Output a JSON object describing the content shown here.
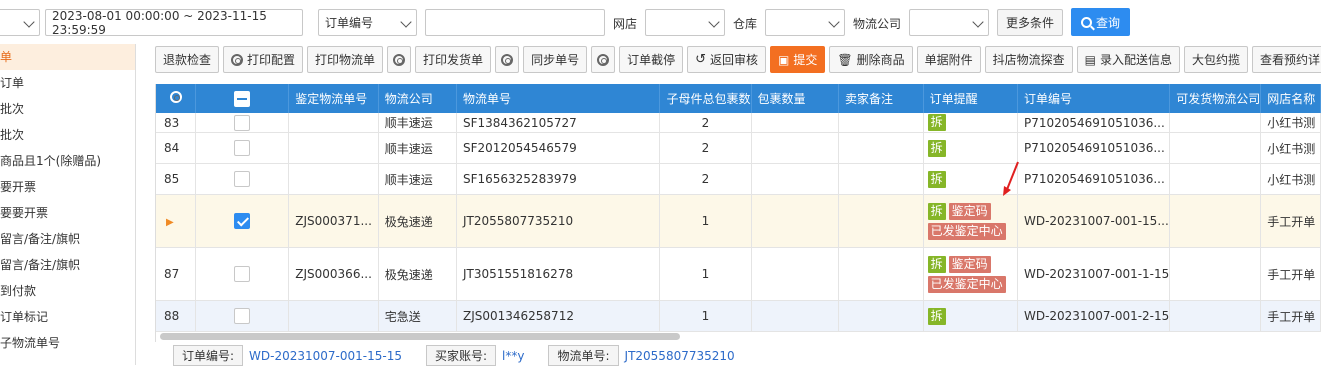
{
  "filters": {
    "date_range": "2023-08-01 00:00:00 ~ 2023-11-15 23:59:59",
    "order_field_select": "订单编号",
    "search_value": "",
    "shop_label": "网店",
    "warehouse_label": "仓库",
    "logistics_label": "物流公司",
    "more_label": "更多条件",
    "search_label": "查询"
  },
  "sidebar": {
    "items": [
      {
        "label": "单"
      },
      {
        "label": "订单"
      },
      {
        "label": "批次"
      },
      {
        "label": "批次"
      },
      {
        "label": "商品且1个(除赠品)"
      },
      {
        "label": "要开票"
      },
      {
        "label": "要要开票"
      },
      {
        "label": "留言/备注/旗帜"
      },
      {
        "label": "留言/备注/旗帜"
      },
      {
        "label": "到付款"
      },
      {
        "label": "订单标记"
      },
      {
        "label": "子物流单号"
      }
    ]
  },
  "toolbar": {
    "refund_check": "退款检查",
    "print_config": "打印配置",
    "print_logistics": "打印物流单",
    "print_delivery": "打印发货单",
    "sync_number": "同步单号",
    "order_intercept": "订单截停",
    "return_review": "返回审核",
    "submit": "提交",
    "delete_product": "删除商品",
    "order_attachment": "单据附件",
    "douyin_probe": "抖店物流探查",
    "entry_delivery": "录入配送信息",
    "big_package": "大包约揽",
    "view_reservation": "查看预约详"
  },
  "table": {
    "columns": [
      "鉴定物流单号",
      "物流公司",
      "物流单号",
      "子母件总包裹数",
      "包裹数量",
      "卖家备注",
      "订单提醒",
      "订单编号",
      "可发货物流公司",
      "网店名称"
    ],
    "rows": [
      {
        "num": "83",
        "checked": false,
        "appraisal": "",
        "company": "顺丰速运",
        "tracking": "SF1384362105727",
        "pkg_total": "2",
        "pkg_count": "",
        "remark": "",
        "tags": [
          "拆"
        ],
        "tags2": [],
        "order_no": "P7102054691051036...",
        "ship_co": "",
        "shop": "小红书测"
      },
      {
        "num": "84",
        "checked": false,
        "appraisal": "",
        "company": "顺丰速运",
        "tracking": "SF2012054546579",
        "pkg_total": "2",
        "pkg_count": "",
        "remark": "",
        "tags": [
          "拆"
        ],
        "tags2": [],
        "order_no": "P7102054691051036...",
        "ship_co": "",
        "shop": "小红书测"
      },
      {
        "num": "85",
        "checked": false,
        "appraisal": "",
        "company": "顺丰速运",
        "tracking": "SF1656325283979",
        "pkg_total": "2",
        "pkg_count": "",
        "remark": "",
        "tags": [
          "拆"
        ],
        "tags2": [],
        "order_no": "P7102054691051036...",
        "ship_co": "",
        "shop": "小红书测"
      },
      {
        "num": "▶",
        "checked": true,
        "appraisal": "ZJS000371...",
        "company": "极兔速递",
        "tracking": "JT2055807735210",
        "pkg_total": "1",
        "pkg_count": "",
        "remark": "",
        "tags": [
          "拆",
          "鉴定码"
        ],
        "tags2": [
          "已发鉴定中心"
        ],
        "order_no": "WD-20231007-001-15...",
        "ship_co": "",
        "shop": "手工开单"
      },
      {
        "num": "87",
        "checked": false,
        "appraisal": "ZJS000366...",
        "company": "极兔速递",
        "tracking": "JT3051551816278",
        "pkg_total": "1",
        "pkg_count": "",
        "remark": "",
        "tags": [
          "拆",
          "鉴定码"
        ],
        "tags2": [
          "已发鉴定中心"
        ],
        "order_no": "WD-20231007-001-1-15",
        "ship_co": "",
        "shop": "手工开单"
      },
      {
        "num": "88",
        "checked": false,
        "appraisal": "",
        "company": "宅急送",
        "tracking": "ZJS001346258712",
        "pkg_total": "1",
        "pkg_count": "",
        "remark": "",
        "tags": [
          "拆"
        ],
        "tags2": [],
        "order_no": "WD-20231007-001-2-15",
        "ship_co": "",
        "shop": "手工开单"
      }
    ]
  },
  "detail": {
    "order_no_label": "订单编号:",
    "order_no": "WD-20231007-001-15-15",
    "buyer_label": "买家账号:",
    "buyer": "l**y",
    "tracking_label": "物流单号:",
    "tracking": "JT2055807735210"
  },
  "colors": {
    "header_blue": "#2f86d4",
    "submit_orange": "#f36f21",
    "tag_green": "#86b628",
    "tag_red": "#d9776a",
    "selected_row": "#fdf8e8"
  }
}
